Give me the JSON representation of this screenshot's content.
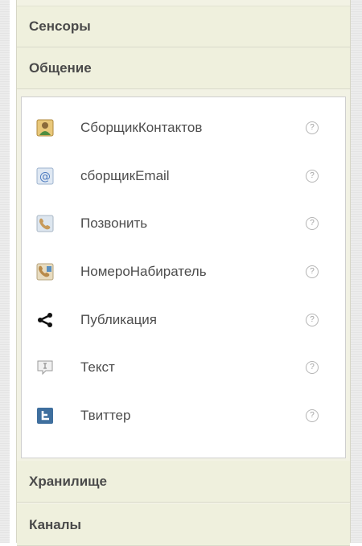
{
  "palette": {
    "drawers": {
      "sensors": {
        "label": "Сенсоры"
      },
      "social": {
        "label": "Общение"
      },
      "storage": {
        "label": "Хранилище"
      },
      "connectivity": {
        "label": "Каналы"
      }
    },
    "social_components": [
      {
        "label": "СборщикКонтактов",
        "icon": "contact-picker-icon"
      },
      {
        "label": "сборщикEmail",
        "icon": "email-picker-icon"
      },
      {
        "label": "Позвонить",
        "icon": "phone-call-icon"
      },
      {
        "label": "НомероНабиратель",
        "icon": "phone-number-picker-icon"
      },
      {
        "label": "Публикация",
        "icon": "sharing-icon"
      },
      {
        "label": "Текст",
        "icon": "texting-icon"
      },
      {
        "label": "Твиттер",
        "icon": "twitter-icon"
      }
    ],
    "help_glyph": "?"
  },
  "colors": {
    "header_bg": "#eff0dd",
    "header_text": "#4a4a4a",
    "content_bg": "#ffffff",
    "label_text": "#4d4d4d"
  }
}
